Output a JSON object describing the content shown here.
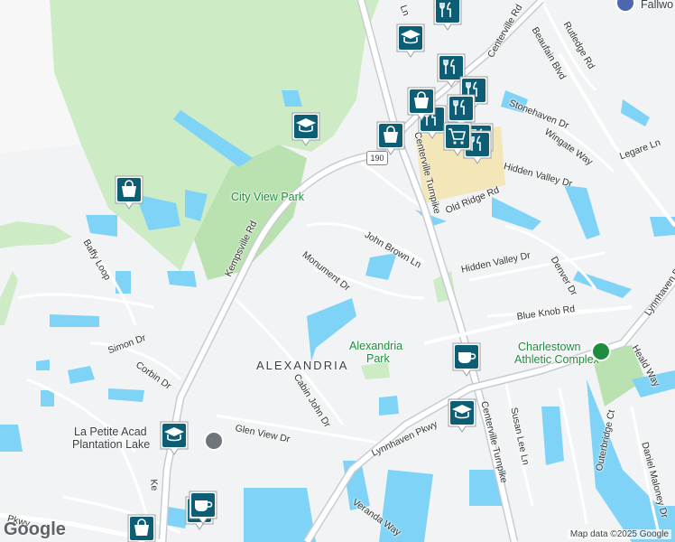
{
  "map": {
    "roads": {
      "kempsville": "Kempsville Rd",
      "monument": "Monument Dr",
      "john_brown": "John Brown Ln",
      "centerville_1": "Centerville Turnpike",
      "centerville_2": "Centerville Turnpike",
      "centerville_top": "Centerville Rd",
      "hidden_valley_1": "Hidden Valley Dr",
      "hidden_valley_2": "Hidden Valley Dr",
      "old_ridge": "Old Ridge Rd",
      "stonehaven": "Stonehaven Dr",
      "wingate": "Wingate Way",
      "legare": "Legare Ln",
      "rutledge": "Rutledge Rd",
      "beaufain": "Beaufain Blvd",
      "denver": "Denver Dr",
      "blue_knob": "Blue Knob Rd",
      "lynnhaven_right": "Lynnhaven Pkwy",
      "lynnhaven_bottom": "Lynnhaven Pkwy",
      "heald": "Heald Way",
      "baffy": "Baffy Loop",
      "simon": "Simon Dr",
      "corbin": "Corbin Dr",
      "cabin_john": "Cabin John Dr",
      "glen_view": "Glen View Dr",
      "veranda": "Veranda Way",
      "susan_lee": "Susan Lee Ln",
      "outerbridge": "Outerbridge Ct",
      "daniel_maloney": "Daniel Maloney Dr",
      "pkwy_left": "Pkwy",
      "ln_top": "Ln",
      "kempsville_bottom": "Ke"
    },
    "route_shield": "190",
    "neighborhood": "ALEXANDRIA",
    "parks": {
      "city_view": "City View Park",
      "alexandria_line1": "Alexandria",
      "alexandria_line2": "Park"
    },
    "pois": {
      "charlestown_line1": "Charlestown",
      "charlestown_line2": "Athletic Complex",
      "la_petite_line1": "La Petite Acad",
      "la_petite_line2": "Plantation Lake",
      "fallwood": "Fallwo"
    },
    "colors": {
      "land": "#f1f3f4",
      "water": "#7fd3f7",
      "park_green": "#cdebc5",
      "poi_blue": "#0d5e75",
      "road": "#ffffff",
      "highway": "#c9ccd0",
      "commercial": "#f3e6b8"
    },
    "markers": [
      {
        "type": "restaurant-icon"
      },
      {
        "type": "restaurant-icon"
      },
      {
        "type": "restaurant-icon"
      },
      {
        "type": "restaurant-icon"
      },
      {
        "type": "restaurant-icon"
      },
      {
        "type": "restaurant-icon"
      },
      {
        "type": "restaurant-icon"
      },
      {
        "type": "restaurant-icon"
      },
      {
        "type": "school-icon"
      },
      {
        "type": "school-icon"
      },
      {
        "type": "school-icon"
      },
      {
        "type": "school-icon"
      },
      {
        "type": "shopping-icon"
      },
      {
        "type": "shopping-icon"
      },
      {
        "type": "shopping-icon"
      },
      {
        "type": "shopping-icon"
      },
      {
        "type": "cafe-icon"
      },
      {
        "type": "cafe-icon"
      },
      {
        "type": "grocery-icon"
      }
    ],
    "branding": "Google",
    "attribution": "Map data ©2025 Google"
  }
}
